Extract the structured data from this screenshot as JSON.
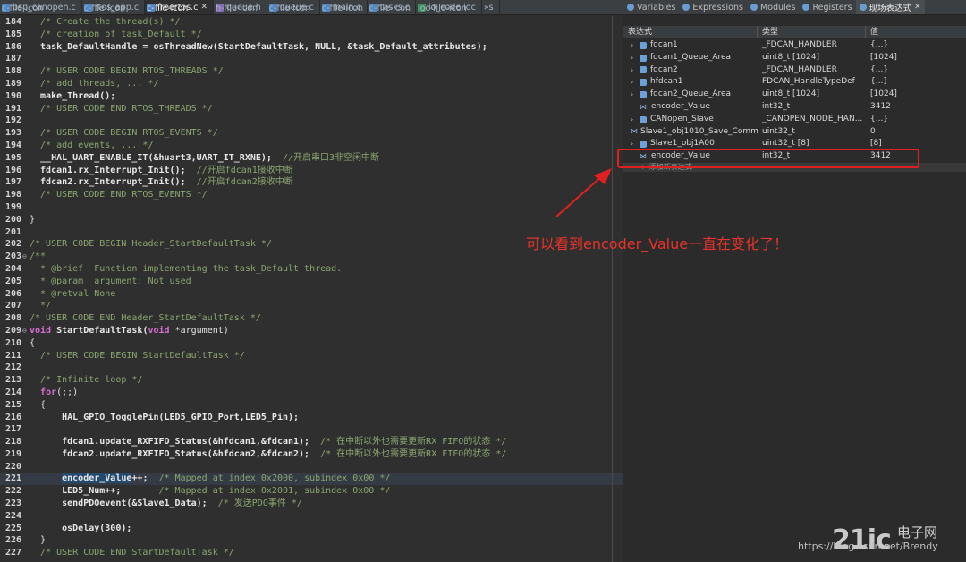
{
  "editor_tabs": [
    {
      "label": "bsp_canopen.c",
      "icon": "c-file-icon",
      "active": false
    },
    {
      "label": "rtos_app.c",
      "icon": "c-file-icon",
      "active": false
    },
    {
      "label": "freertos.c",
      "icon": "c-file-icon",
      "active": true,
      "close": "✕"
    },
    {
      "label": "queue.h",
      "icon": "h-file-icon",
      "active": false
    },
    {
      "label": "queue.c",
      "icon": "c-file-icon",
      "active": false
    },
    {
      "label": "main.c",
      "icon": "c-file-icon",
      "active": false
    },
    {
      "label": "tasks.c",
      "icon": "c-file-icon",
      "active": false
    },
    {
      "label": "io_code.ioc",
      "icon": "ioc-file-icon",
      "active": false
    },
    {
      "label": "»s",
      "icon": "",
      "active": false
    }
  ],
  "code_lines": [
    {
      "num": "184",
      "fold": "",
      "text": "  /* Create the thread(s) */",
      "cls": "cm"
    },
    {
      "num": "185",
      "fold": "",
      "text": "  /* creation of task_Default */",
      "cls": "cm"
    },
    {
      "num": "186",
      "fold": "",
      "text": "  task_DefaultHandle = osThreadNew(StartDefaultTask, NULL, &task_Default_attributes);",
      "cls": "fn"
    },
    {
      "num": "187",
      "fold": "",
      "text": "",
      "cls": ""
    },
    {
      "num": "188",
      "fold": "",
      "text": "  /* USER CODE BEGIN RTOS_THREADS */",
      "cls": "cm"
    },
    {
      "num": "189",
      "fold": "",
      "text": "  /* add threads, ... */",
      "cls": "cm"
    },
    {
      "num": "190",
      "fold": "",
      "text": "  make_Thread();",
      "cls": "fn"
    },
    {
      "num": "191",
      "fold": "",
      "text": "  /* USER CODE END RTOS_THREADS */",
      "cls": "cm"
    },
    {
      "num": "192",
      "fold": "",
      "text": "",
      "cls": ""
    },
    {
      "num": "193",
      "fold": "",
      "text": "  /* USER CODE BEGIN RTOS_EVENTS */",
      "cls": "cm"
    },
    {
      "num": "194",
      "fold": "",
      "text": "  /* add events, ... */",
      "cls": "cm"
    },
    {
      "num": "195",
      "fold": "",
      "text": "  __HAL_UART_ENABLE_IT(&huart3,UART_IT_RXNE);  //开启串口3非空闲中断",
      "cls": "fn"
    },
    {
      "num": "196",
      "fold": "",
      "text": "  fdcan1.rx_Interrupt_Init();  //开启fdcan1接收中断",
      "cls": "fn"
    },
    {
      "num": "197",
      "fold": "",
      "text": "  fdcan2.rx_Interrupt_Init();  //开启fdcan2接收中断",
      "cls": "fn"
    },
    {
      "num": "198",
      "fold": "",
      "text": "  /* USER CODE END RTOS_EVENTS */",
      "cls": "cm"
    },
    {
      "num": "199",
      "fold": "",
      "text": "",
      "cls": ""
    },
    {
      "num": "200",
      "fold": "",
      "text": "}",
      "cls": ""
    },
    {
      "num": "201",
      "fold": "",
      "text": "",
      "cls": ""
    },
    {
      "num": "202",
      "fold": "",
      "text": "/* USER CODE BEGIN Header_StartDefaultTask */",
      "cls": "cm"
    },
    {
      "num": "203",
      "fold": "⊖",
      "text": "/**",
      "cls": "cm"
    },
    {
      "num": "204",
      "fold": "",
      "text": "  * @brief  Function implementing the task_Default thread.",
      "cls": "cm"
    },
    {
      "num": "205",
      "fold": "",
      "text": "  * @param  argument: Not used",
      "cls": "cm"
    },
    {
      "num": "206",
      "fold": "",
      "text": "  * @retval None",
      "cls": "cm"
    },
    {
      "num": "207",
      "fold": "",
      "text": "  */",
      "cls": "cm"
    },
    {
      "num": "208",
      "fold": "",
      "text": "/* USER CODE END Header_StartDefaultTask */",
      "cls": "cm"
    },
    {
      "num": "209",
      "fold": "⊖",
      "text": "void StartDefaultTask(void *argument)",
      "cls": "decl"
    },
    {
      "num": "210",
      "fold": "",
      "text": "{",
      "cls": ""
    },
    {
      "num": "211",
      "fold": "",
      "text": "  /* USER CODE BEGIN StartDefaultTask */",
      "cls": "cm"
    },
    {
      "num": "212",
      "fold": "",
      "text": "",
      "cls": ""
    },
    {
      "num": "213",
      "fold": "",
      "text": "  /* Infinite loop */",
      "cls": "cm"
    },
    {
      "num": "214",
      "fold": "",
      "text": "  for(;;)",
      "cls": "for"
    },
    {
      "num": "215",
      "fold": "",
      "text": "  {",
      "cls": ""
    },
    {
      "num": "216",
      "fold": "",
      "text": "      HAL_GPIO_TogglePin(LED5_GPIO_Port,LED5_Pin);",
      "cls": "fn"
    },
    {
      "num": "217",
      "fold": "",
      "text": "",
      "cls": ""
    },
    {
      "num": "218",
      "fold": "",
      "text": "      fdcan1.update_RXFIFO_Status(&hfdcan1,&fdcan1);  /* 在中断以外也需要更新RX FIFO的状态 */",
      "cls": "fn"
    },
    {
      "num": "219",
      "fold": "",
      "text": "      fdcan2.update_RXFIFO_Status(&hfdcan2,&fdcan2);  /* 在中断以外也需要更新RX FIFO的状态 */",
      "cls": "fn"
    },
    {
      "num": "220",
      "fold": "",
      "text": "",
      "cls": ""
    },
    {
      "num": "221",
      "fold": "",
      "text": "      encoder_Value++;  /* Mapped at index 0x2000, subindex 0x00 */",
      "cls": "sel"
    },
    {
      "num": "222",
      "fold": "",
      "text": "      LED5_Num++;       /* Mapped at index 0x2001, subindex 0x00 */",
      "cls": "fn"
    },
    {
      "num": "223",
      "fold": "",
      "text": "      sendPDOevent(&Slave1_Data);  /* 发送PDO事件 */",
      "cls": "fn"
    },
    {
      "num": "224",
      "fold": "",
      "text": "",
      "cls": ""
    },
    {
      "num": "225",
      "fold": "",
      "text": "      osDelay(300);",
      "cls": "fn"
    },
    {
      "num": "226",
      "fold": "",
      "text": "  }",
      "cls": ""
    },
    {
      "num": "227",
      "fold": "",
      "text": "  /* USER CODE END StartDefaultTask */",
      "cls": "cm"
    }
  ],
  "view_tabs": [
    {
      "label": "Variables",
      "icon": "variables-icon",
      "active": false
    },
    {
      "label": "Expressions",
      "icon": "expressions-icon",
      "active": false
    },
    {
      "label": "Modules",
      "icon": "modules-icon",
      "active": false
    },
    {
      "label": "Registers",
      "icon": "registers-icon",
      "active": false
    },
    {
      "label": "现场表达式",
      "icon": "live-expressions-icon",
      "active": true,
      "close": "✕"
    }
  ],
  "grid_headers": [
    "表达式",
    "类型",
    "值"
  ],
  "rows": [
    {
      "exp": "›",
      "icon": "struct-icon",
      "name": "fdcan1",
      "type": "_FDCAN_HANDLER",
      "value": "{...}"
    },
    {
      "exp": "›",
      "icon": "struct-icon",
      "name": "fdcan1_Queue_Area",
      "type": "uint8_t [1024]",
      "value": "[1024]"
    },
    {
      "exp": "›",
      "icon": "struct-icon",
      "name": "fdcan2",
      "type": "_FDCAN_HANDLER",
      "value": "{...}"
    },
    {
      "exp": "›",
      "icon": "struct-icon",
      "name": "hfdcan1",
      "type": "FDCAN_HandleTypeDef",
      "value": "{...}"
    },
    {
      "exp": "›",
      "icon": "struct-icon",
      "name": "fdcan2_Queue_Area",
      "type": "uint8_t [1024]",
      "value": "[1024]"
    },
    {
      "exp": "",
      "icon": "variable-icon",
      "name": "encoder_Value",
      "type": "int32_t",
      "value": "3412"
    },
    {
      "exp": "›",
      "icon": "struct-icon",
      "name": "CANopen_Slave",
      "type": "_CANOPEN_NODE_HAN...",
      "value": "{...}"
    },
    {
      "exp": "",
      "icon": "variable-icon",
      "name": "Slave1_obj1010_Save_Comm",
      "type": "uint32_t",
      "value": "0"
    },
    {
      "exp": "›",
      "icon": "struct-icon",
      "name": "Slave1_obj1A00",
      "type": "uint32_t [8]",
      "value": "[8]"
    },
    {
      "exp": "",
      "icon": "variable-icon",
      "name": "encoder_Value",
      "type": "int32_t",
      "value": "3412"
    }
  ],
  "add_row": {
    "plus": "+",
    "label": "添加新表达式"
  },
  "annotation": {
    "text": "可以看到encoder_Value一直在变化了！",
    "color": "#e8322a"
  },
  "watermark": {
    "logo": "21ic",
    "cn": "电子网",
    "url": "https://blog.csdn.net/Brendy"
  }
}
